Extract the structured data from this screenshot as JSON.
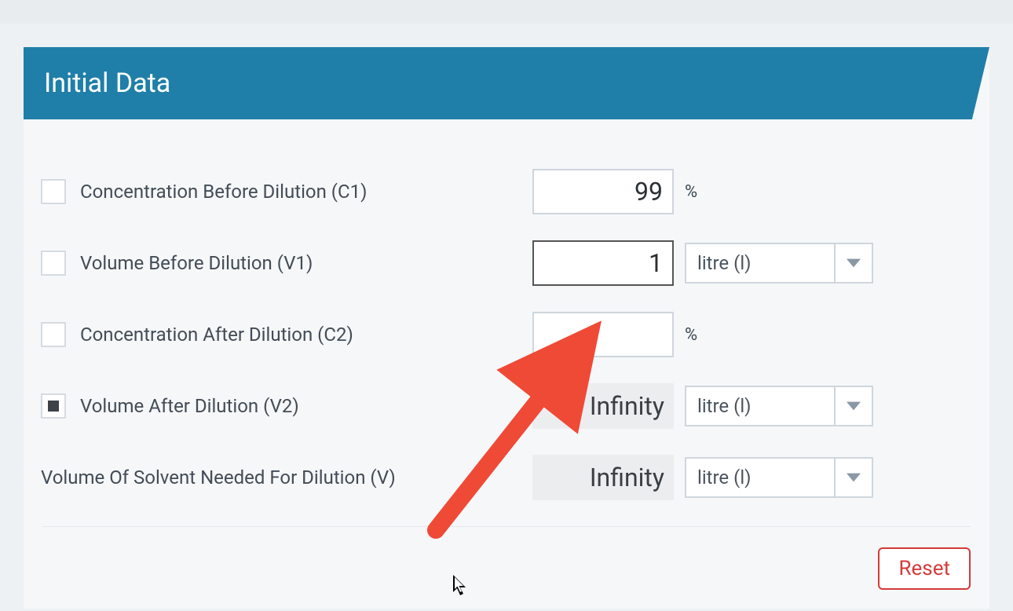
{
  "header": {
    "title": "Initial Data"
  },
  "rows": {
    "c1": {
      "label": "Concentration Before Dilution (C1)",
      "checked": false,
      "value": "99",
      "unit": "%"
    },
    "v1": {
      "label": "Volume Before Dilution (V1)",
      "checked": false,
      "value": "1",
      "unit_select": "litre (l)",
      "focused": true
    },
    "c2": {
      "label": "Concentration After Dilution (C2)",
      "checked": false,
      "value": "",
      "unit": "%"
    },
    "v2": {
      "label": "Volume After Dilution (V2)",
      "checked": true,
      "value": "Infinity",
      "readonly": true,
      "unit_select": "litre (l)"
    },
    "v": {
      "label": "Volume Of Solvent Needed For Dilution (V)",
      "value": "Infinity",
      "readonly": true,
      "unit_select": "litre (l)"
    }
  },
  "footer": {
    "reset": "Reset"
  }
}
